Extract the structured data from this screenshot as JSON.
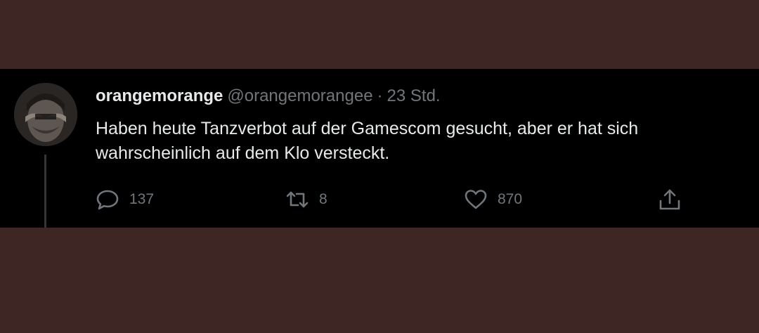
{
  "tweet": {
    "display_name": "orangemorange",
    "handle": "@orangemorangee",
    "separator": "·",
    "time": "23 Std.",
    "text": "Haben heute Tanzverbot auf der Gamescom gesucht, aber er hat sich wahrscheinlich auf dem Klo versteckt."
  },
  "actions": {
    "reply": {
      "icon": "reply-icon",
      "count": "137"
    },
    "retweet": {
      "icon": "retweet-icon",
      "count": "8"
    },
    "like": {
      "icon": "heart-icon",
      "count": "870"
    },
    "share": {
      "icon": "share-icon"
    }
  },
  "colors": {
    "page_background": "#3d2624",
    "tweet_background": "#000000",
    "primary_text": "#e7e9ea",
    "secondary_text": "#71767b"
  }
}
